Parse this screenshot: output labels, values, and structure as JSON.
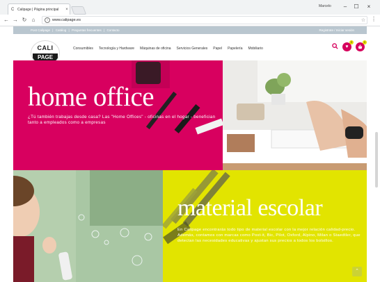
{
  "browser": {
    "tab_title": "Calipage | Página principal",
    "tab_close": "×",
    "profile_name": "Marcelo",
    "window_controls": [
      "–",
      "☐",
      "×"
    ],
    "url": "www.calipage.es"
  },
  "site": {
    "top_links": [
      "Post Calipage",
      "|",
      "Catálog",
      "|",
      "Preguntas frecuentes",
      "|",
      "Contacto"
    ],
    "register_link": "Registrate / Iniciar sesión",
    "logo_top": "CALI",
    "logo_bottom": "PAGE",
    "nav": [
      "Consumibles",
      "Tecnología y Hardware",
      "Máquinas de oficina",
      "Servicios Generales",
      "Papel",
      "Papelería",
      "Mobiliario"
    ],
    "wishlist_count": "0",
    "cart_count": "0",
    "icons": [
      "search-icon",
      "heart-icon",
      "basket-icon"
    ],
    "accent": "#d6005c"
  },
  "banners": {
    "home_office": {
      "title": "home office",
      "text": "¿Tú también trabajas desde casa? Las \"Home Offices\" - oficinas en el hogar - benefician tanto a empleados como a empresas",
      "bg": "#d8005f"
    },
    "material_escolar": {
      "title": "material escolar",
      "text": "En Calipage encontrarás todo tipo de material escolar con la mejor relación calidad-precio. Además, contamos con marcas como Post-it, Bic, Pilot, Oxford, Alpino, Milan o Staedtler, que detectan las necesidades educativas y ajustan sus precios a todos los bolsillos.",
      "bg": "#e2e400"
    }
  }
}
